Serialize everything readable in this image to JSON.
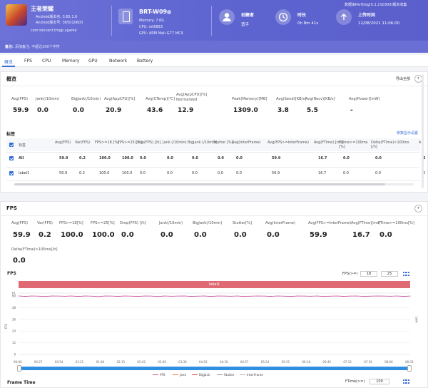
{
  "header": {
    "app_name": "王者荣耀",
    "android_version": "Android版本名: 3.65.1.6",
    "android_version_code": "Android版本号: 365010603",
    "package": "com.tencent.tmgp.sgame",
    "device_name": "BRT-W09",
    "memory": "Memory: 7.6G",
    "cpu": "CPU: mt6893",
    "gpu": "GPU: ARM Mali-G77 MC9",
    "creator_label": "创建者",
    "creator_value": "造乎",
    "duration_label": "时长",
    "duration_value": "0h 8m 41s",
    "upload_label": "上传时间",
    "upload_value": "12/08/2021 11:06:00",
    "feedback": "数据由PerfDog(5.1.210300)版本收集"
  },
  "note": {
    "label": "备注:",
    "text": "添加备注,  不超过200个字符"
  },
  "tabs": [
    "概览",
    "FPS",
    "CPU",
    "Memory",
    "GPU",
    "Network",
    "Battery"
  ],
  "overview": {
    "title": "概览",
    "export_link": "导出全部",
    "metrics": [
      {
        "label": "Avg(FPS)",
        "value": "59.9"
      },
      {
        "label": "Jank(/10min)",
        "value": "0.0"
      },
      {
        "label": "BigJank(/10min)",
        "value": "0.0"
      },
      {
        "label": "Avg(AppCPU)[%]",
        "value": "20.9"
      },
      {
        "label": "Avg(CTemp)[℃]",
        "value": "43.6"
      },
      {
        "label": "Avg(AppCPU)[%] Normalized",
        "value": "12.9"
      },
      {
        "label": "Peak(Memory)[MB]",
        "value": "1309.0"
      },
      {
        "label": "Avg(Send)[KB/s]",
        "value": "3.8"
      },
      {
        "label": "Avg(Recv)[KB/s]",
        "value": "5.5"
      },
      {
        "label": "Avg(Power)[mW]",
        "value": "-"
      }
    ]
  },
  "label_table": {
    "title": "标签",
    "settings_link": "参数显示设置",
    "headers": [
      "标签",
      "Avg(FPS)",
      "Var(FPS)",
      "FPS>=18 [%]",
      "FPS>=25 [%]",
      "Drop(FPS) [/h]",
      "Jank (/10min)",
      "BigJank (/10min)",
      "Stutter [%]",
      "Avg(InterFrame)",
      "Avg(FPS>=InterFrame)",
      "Avg(FTime) [ms]",
      "FTime>=100ms [%]",
      "Delta(FTime)>100ms [/h]",
      "A"
    ],
    "rows": [
      {
        "name": "All",
        "cells": [
          "59.9",
          "0.2",
          "100.0",
          "100.0",
          "0.0",
          "0.0",
          "0.0",
          "0.0",
          "0.0",
          "59.9",
          "16.7",
          "0.0",
          "0.0",
          "2"
        ]
      },
      {
        "name": "label1",
        "cells": [
          "59.9",
          "0.2",
          "100.0",
          "100.0",
          "0.0",
          "0.0",
          "0.0",
          "0.0",
          "0.0",
          "59.9",
          "16.7",
          "0.0",
          "0.0",
          "2"
        ]
      }
    ]
  },
  "fps_panel": {
    "title": "FPS",
    "metrics": [
      {
        "label": "Avg(FPS)",
        "value": "59.9"
      },
      {
        "label": "Var(FPS)",
        "value": "0.2"
      },
      {
        "label": "FPS>=18[%]",
        "value": "100.0"
      },
      {
        "label": "FPS>=25[%]",
        "value": "100.0"
      },
      {
        "label": "Drop(FPS) [/h]",
        "value": "0.0"
      },
      {
        "label": "Jank(/10min)",
        "value": "0.0"
      },
      {
        "label": "BigJank(/10min)",
        "value": "0.0"
      },
      {
        "label": "Stutter[%]",
        "value": "0.0"
      },
      {
        "label": "Avg(InterFrame)",
        "value": "0.0"
      },
      {
        "label": "Avg(FPS>=InterFrame)",
        "value": "59.9"
      },
      {
        "label": "Avg(FTime)[ms]",
        "value": "16.7"
      },
      {
        "label": "FTime>=100ms[%]",
        "value": "0.0"
      },
      {
        "label": "Delta(FTime)>100ms[/h]",
        "value": "0.0"
      }
    ]
  },
  "fps_chart": {
    "title": "FPS",
    "fps_ctl_label": "FPS(>=)",
    "fps_ctl_a": "18",
    "fps_ctl_b": "25",
    "band_label": "label1",
    "y_axis_label": "FPS",
    "right_axis_label": "Jank"
  },
  "frame_time": {
    "title": "Frame Time",
    "ctl_label": "FTime(>=)",
    "ctl_value": "100"
  },
  "chart_data": {
    "type": "line",
    "title": "FPS",
    "xlabel": "",
    "ylabel": "FPS",
    "y_ticks": [
      "61",
      "60",
      "48",
      "36",
      "24",
      "12",
      "0"
    ],
    "x_ticks": [
      "00:00",
      "00:27",
      "00:54",
      "01:21",
      "01:48",
      "02:15",
      "02:42",
      "03:09",
      "03:36",
      "04:03",
      "04:30",
      "04:57",
      "05:24",
      "05:51",
      "06:18",
      "06:45",
      "07:12",
      "07:39",
      "08:06",
      "08:33"
    ],
    "ylim": [
      0,
      61
    ],
    "series": [
      {
        "name": "FPS",
        "color": "#c64a9a",
        "values": [
          60,
          59.6,
          60,
          59.8,
          59.4,
          60,
          59.9,
          59.7,
          60,
          59.5,
          60,
          59.8,
          59.3,
          60,
          59.9,
          59.6,
          60,
          59.8,
          59.5,
          60,
          59.9,
          59.4,
          60,
          59.7,
          59.9,
          60,
          59.6,
          59.8,
          60,
          59.5,
          60,
          59.9,
          59.7,
          60,
          59.4,
          59.8,
          60,
          59.9,
          59.6,
          60,
          59.8,
          59.5,
          60,
          59.9,
          59.7,
          60,
          59.4,
          59.8,
          60,
          59.6,
          59.9,
          60,
          59.5,
          59.8,
          60,
          59.9,
          59.7,
          60,
          59.6,
          59.9
        ]
      },
      {
        "name": "Jank",
        "color": "#e07c3a",
        "values": []
      },
      {
        "name": "BigJank",
        "color": "#d23838",
        "values": []
      },
      {
        "name": "Stutter",
        "color": "#8a8a8a",
        "values": []
      },
      {
        "name": "InterFrame",
        "color": "#b0b0b0",
        "values": []
      }
    ],
    "legend": "bottom"
  }
}
